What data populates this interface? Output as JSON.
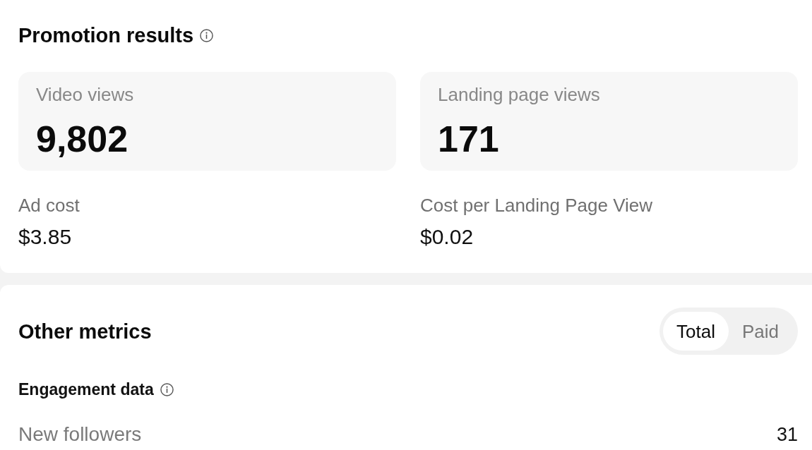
{
  "promotion_results": {
    "title": "Promotion results",
    "tiles": [
      {
        "label": "Video views",
        "value": "9,802"
      },
      {
        "label": "Landing page views",
        "value": "171"
      }
    ],
    "stats": [
      {
        "label": "Ad cost",
        "value": "$3.85"
      },
      {
        "label": "Cost per Landing Page View",
        "value": "$0.02"
      }
    ]
  },
  "other_metrics": {
    "title": "Other metrics",
    "toggle": [
      {
        "label": "Total",
        "selected": true
      },
      {
        "label": "Paid",
        "selected": false
      }
    ],
    "section_title": "Engagement data",
    "rows": [
      {
        "label": "New followers",
        "value": "31"
      }
    ]
  }
}
